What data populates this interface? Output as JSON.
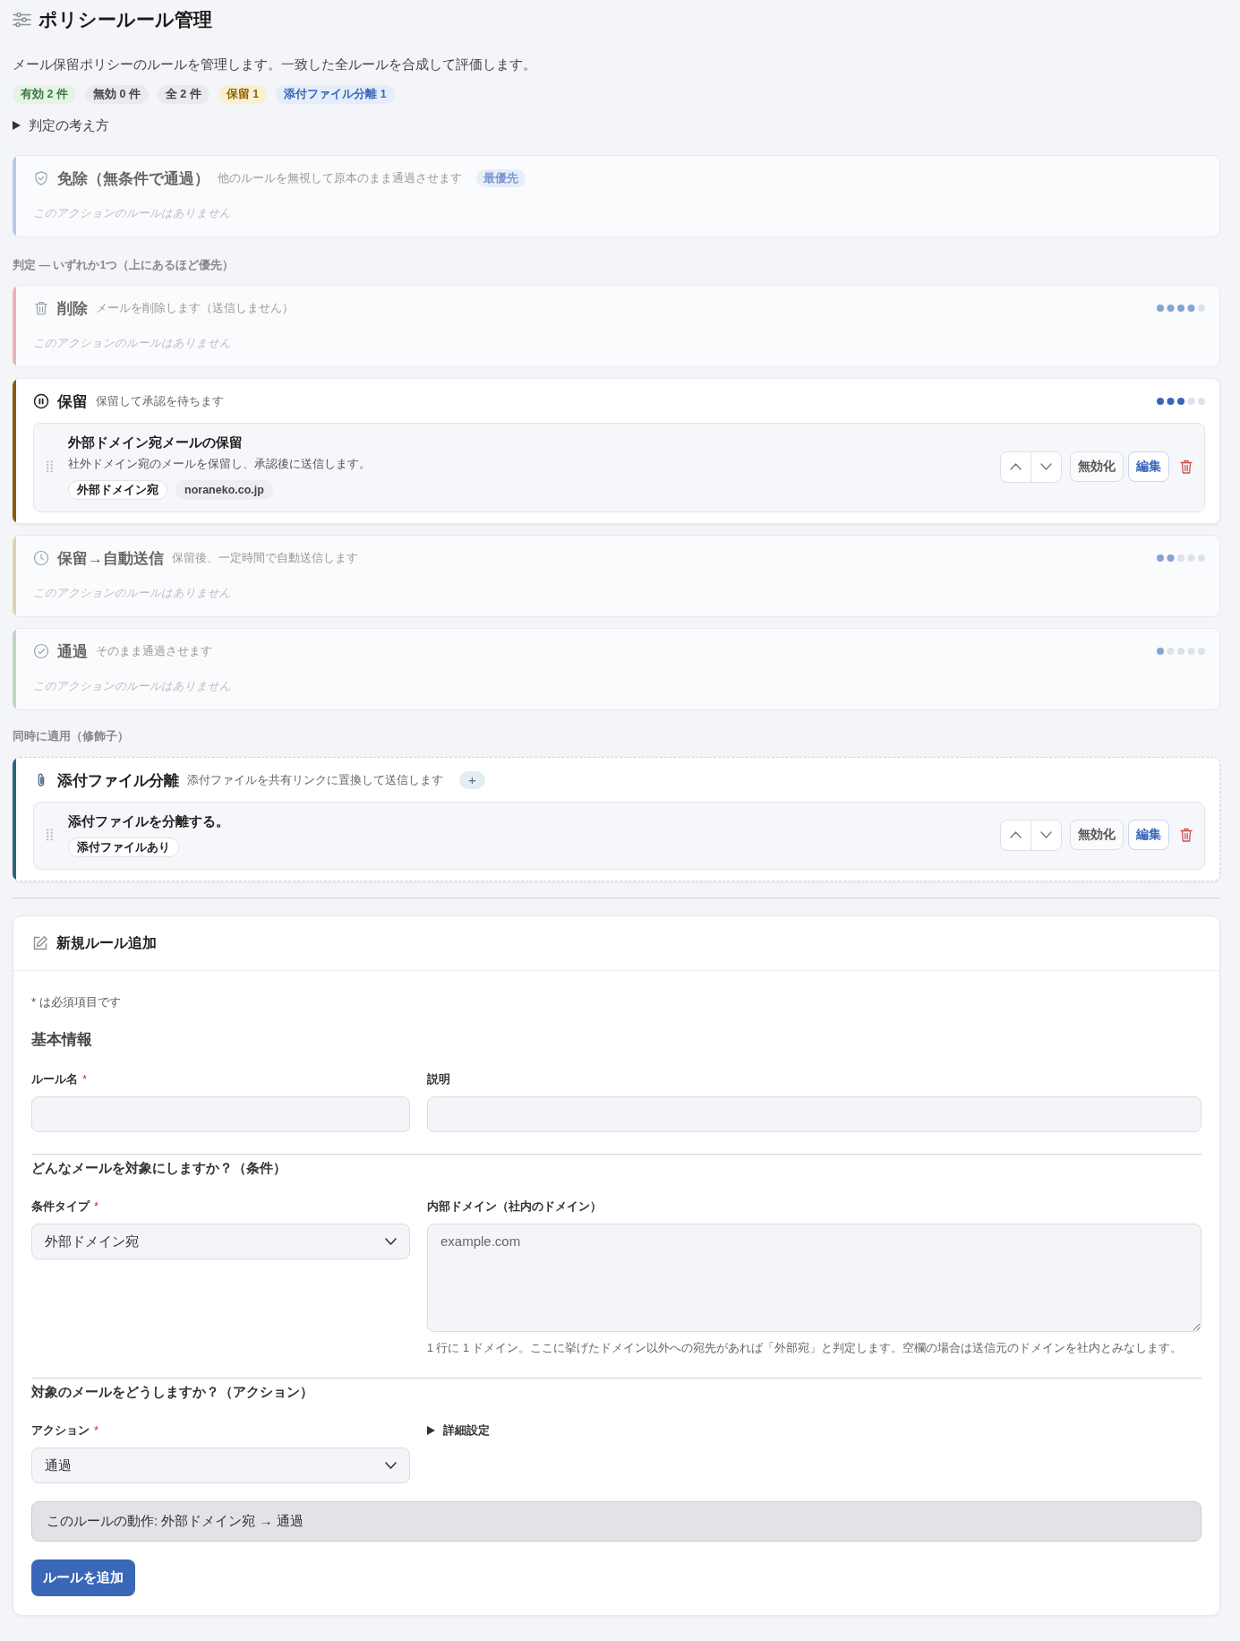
{
  "header": {
    "title": "ポリシールール管理",
    "description": "メール保留ポリシーのルールを管理します。一致した全ルールを合成して評価します。",
    "badges": [
      {
        "text": "有効 2 件",
        "kind": "enabled"
      },
      {
        "text": "無効 0 件",
        "kind": "disabled"
      },
      {
        "text": "全 2 件",
        "kind": "total"
      },
      {
        "text": "保留 1",
        "kind": "hold"
      },
      {
        "text": "添付ファイル分離 1",
        "kind": "attachment"
      }
    ],
    "disclosure": {
      "label": "判定の考え方",
      "expanded": false
    }
  },
  "exemption": {
    "kind": "exempt",
    "title": "免除（無条件で通過）",
    "description": "他のルールを無視して原本のまま通過させます",
    "badge": "最優先",
    "color": "#b8c8e8",
    "empty_text": "このアクションのルールはありません"
  },
  "decisions": {
    "label": "判定 — いずれか1つ（上にあるほど優先）",
    "cards": [
      {
        "kind": "delete",
        "title": "削除",
        "description": "メールを削除します（送信しません）",
        "color": "#e8b4ba",
        "level": 0.8,
        "empty_text": "このアクションのルールはありません"
      },
      {
        "kind": "hold",
        "title": "保留",
        "description": "保留して承認を待ちます",
        "color": "#8a5a0c",
        "level": 0.6,
        "rules": [
          {
            "title": "外部ドメイン宛メールの保留",
            "description": "社外ドメイン宛のメールを保留し、承認後に送信します。",
            "tags": [
              {
                "text": "外部ドメイン宛",
                "kind": "condition"
              },
              {
                "text": "noraneko.co.jp",
                "kind": "value"
              }
            ],
            "disable_label": "無効化",
            "edit_label": "編集"
          }
        ]
      },
      {
        "kind": "hold_autosend",
        "title": "保留→自動送信",
        "description": "保留後、一定時間で自動送信します",
        "color": "#ddd2b4",
        "level": 0.4,
        "empty_text": "このアクションのルールはありません"
      },
      {
        "kind": "pass",
        "title": "通過",
        "description": "そのまま通過させます",
        "color": "#bfd8c0",
        "level": 0.2,
        "empty_text": "このアクションのルールはありません"
      }
    ]
  },
  "modifiers": {
    "label": "同時に適用（修飾子）",
    "cards": [
      {
        "kind": "attachment_split",
        "title": "添付ファイル分離",
        "description": "添付ファイルを共有リンクに置換して送信します",
        "add_label": "+",
        "color": "#2f6379",
        "rules": [
          {
            "title": "添付ファイルを分離する。",
            "tags": [
              {
                "text": "添付ファイルあり",
                "kind": "condition"
              }
            ],
            "disable_label": "無効化",
            "edit_label": "編集"
          }
        ]
      }
    ]
  },
  "new_rule": {
    "title": "新規ルール追加",
    "required_note": "* は必須項目です",
    "required_mark": "*",
    "sections": [
      {
        "heading": "基本情報",
        "fields": [
          {
            "kind": "text",
            "label": "ルール名",
            "required": true
          },
          {
            "kind": "text",
            "label": "説明",
            "required": false
          }
        ]
      },
      {
        "heading": "どんなメールを対象にしますか？（条件）",
        "fields": [
          {
            "kind": "select",
            "label": "条件タイプ",
            "required": true,
            "value": "外部ドメイン宛"
          },
          {
            "kind": "textarea",
            "label": "内部ドメイン（社内のドメイン）",
            "required": false,
            "placeholder": "example.com",
            "help": "1 行に 1 ドメイン。ここに挙げたドメイン以外への宛先があれば「外部宛」と判定します。空欄の場合は送信元のドメインを社内とみなします。"
          }
        ]
      },
      {
        "heading": "対象のメールをどうしますか？（アクション）",
        "fields": [
          {
            "kind": "select",
            "label": "アクション",
            "required": true,
            "value": "通過"
          },
          {
            "kind": "disclosure",
            "label": "詳細設定",
            "expanded": false
          }
        ]
      }
    ],
    "summary": "このルールの動作: 外部ドメイン宛 → 通過",
    "submit_label": "ルールを追加"
  }
}
